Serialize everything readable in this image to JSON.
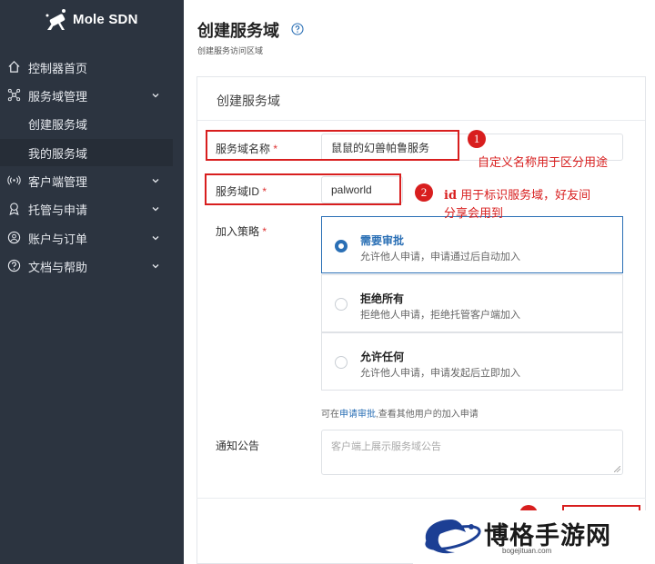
{
  "app": {
    "logo_text": "Mole SDN"
  },
  "sidebar": {
    "items": [
      {
        "label": "控制器首页",
        "icon": "home-icon"
      },
      {
        "label": "服务域管理",
        "icon": "network-icon"
      },
      {
        "label": "创建服务域"
      },
      {
        "label": "我的服务域"
      },
      {
        "label": "客户端管理",
        "icon": "signal-icon"
      },
      {
        "label": "托管与申请",
        "icon": "award-icon"
      },
      {
        "label": "账户与订单",
        "icon": "user-icon"
      },
      {
        "label": "文档与帮助",
        "icon": "help-icon"
      }
    ]
  },
  "header": {
    "title": "创建服务域",
    "subtitle": "创建服务访问区域"
  },
  "card": {
    "title": "创建服务域"
  },
  "form": {
    "name_label": "服务域名称",
    "name_value": "鼠鼠的幻兽帕鲁服务",
    "id_label": "服务域ID",
    "id_value": "palworld",
    "required_mark": "*",
    "policy_label": "加入策略",
    "policies": [
      {
        "title": "需要审批",
        "desc": "允许他人申请，申请通过后自动加入",
        "selected": true
      },
      {
        "title": "拒绝所有",
        "desc": "拒绝他人申请，拒绝托管客户端加入",
        "selected": false
      },
      {
        "title": "允许任何",
        "desc": "允许他人申请，申请发起后立即加入",
        "selected": false
      }
    ],
    "hint_prefix": "可在",
    "hint_link": "申请审批",
    "hint_suffix": ",查看其他用户的加入申请",
    "notice_label": "通知公告",
    "notice_placeholder": "客户端上展示服务域公告"
  },
  "annotations": {
    "one_num": "1",
    "one_text": "自定义名称用于区分用途",
    "two_num": "2",
    "two_text_bold": "id",
    "two_text_line1": " 用于标识服务域，好友间",
    "two_text_line2": "分享会用到"
  },
  "watermark": {
    "text": "博格手游网",
    "sub": "bogejituan.com"
  },
  "colors": {
    "sidebar_bg": "#2c3440",
    "accent": "#2a6fb5",
    "annotation": "#d81e1e"
  }
}
